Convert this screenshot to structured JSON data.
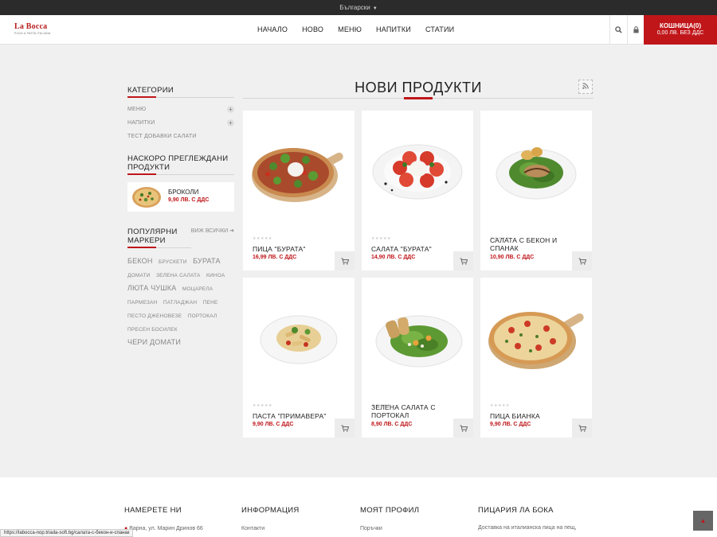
{
  "topbar": {
    "language": "Български"
  },
  "header": {
    "logo": {
      "name": "La Bocca",
      "tagline": "PIZZA & PASTA ITALIANA"
    },
    "nav": [
      "НАЧАЛО",
      "НОВО",
      "МЕНЮ",
      "НАПИТКИ",
      "СТАТИИ"
    ],
    "cart": {
      "label": "КОШНИЦА(0)",
      "total": "0,00 ЛВ. БЕЗ ДДС"
    },
    "icons": [
      "search-icon",
      "lock-icon"
    ]
  },
  "sidebar": {
    "categories_title": "КАТЕГОРИИ",
    "categories": [
      "МЕНЮ",
      "НАПИТКИ",
      "ТЕСТ ДОБАВКИ САЛАТИ"
    ],
    "recent_title": "НАСКОРО ПРЕГЛЕЖДАНИ ПРОДУКТИ",
    "recent_product": {
      "name": "БРОКОЛИ",
      "price": "9,90 ЛВ. С ДДС"
    },
    "tags_title": "ПОПУЛЯРНИ МАРКЕРИ",
    "see_all": "ВИЖ ВСИЧКИ",
    "tags": [
      "БЕКОН",
      "БРУСКЕТИ",
      "БУРАТА",
      "ДОМАТИ",
      "ЗЕЛЕНА САЛАТА",
      "КИНОА",
      "ЛЮТА ЧУШКА",
      "МОЦАРЕЛА",
      "ПАРМЕЗАН",
      "ПАТЛАДЖАН",
      "ПЕНЕ",
      "ПЕСТО ДЖЕНОВЕЗЕ",
      "ПОРТОКАЛ",
      "ПРЕСЕН БОСИЛЕК",
      "ЧЕРИ ДОМАТИ"
    ]
  },
  "main": {
    "title": "НОВИ ПРОДУКТИ",
    "products": [
      {
        "name": "ПИЦА \"БУРАТА\"",
        "price": "16,99 ЛВ. С ДДС",
        "stars": "★★★★★"
      },
      {
        "name": "САЛАТА \"БУРАТА\"",
        "price": "14,90 ЛВ. С ДДС",
        "stars": "★★★★★"
      },
      {
        "name": "САЛАТА С БЕКОН И СПАНАК",
        "price": "10,90 ЛВ. С ДДС",
        "stars": "★★★★★"
      },
      {
        "name": "ПАСТА \"ПРИМАВЕРА\"",
        "price": "9,90 ЛВ. С ДДС",
        "stars": "★★★★★"
      },
      {
        "name": "ЗЕЛЕНА САЛАТА С ПОРТОКАЛ",
        "price": "8,90 ЛВ. С ДДС",
        "stars": "★★★★★"
      },
      {
        "name": "ПИЦА БИАНКА",
        "price": "9,90 ЛВ. С ДДС",
        "stars": "★★★★★"
      }
    ]
  },
  "footer": {
    "find_us_title": "НАМЕРЕТЕ НИ",
    "address": "Варна, ул. Марин Дринов 66",
    "info_title": "ИНФОРМАЦИЯ",
    "info_link": "Контакти",
    "profile_title": "МОЯТ ПРОФИЛ",
    "profile_link": "Поръчки",
    "about_title": "ПИЦАРИЯ ЛА БОКА",
    "about_text": "Доставка на италианска пица на пещ,"
  },
  "status_bar": {
    "url": "https://labocca-nop.triada-soft.bg/салата-с-бекон-и-спанак"
  },
  "colors": {
    "accent": "#c0161a",
    "topbar": "#2b2b2b",
    "background": "#f0f0f0"
  }
}
